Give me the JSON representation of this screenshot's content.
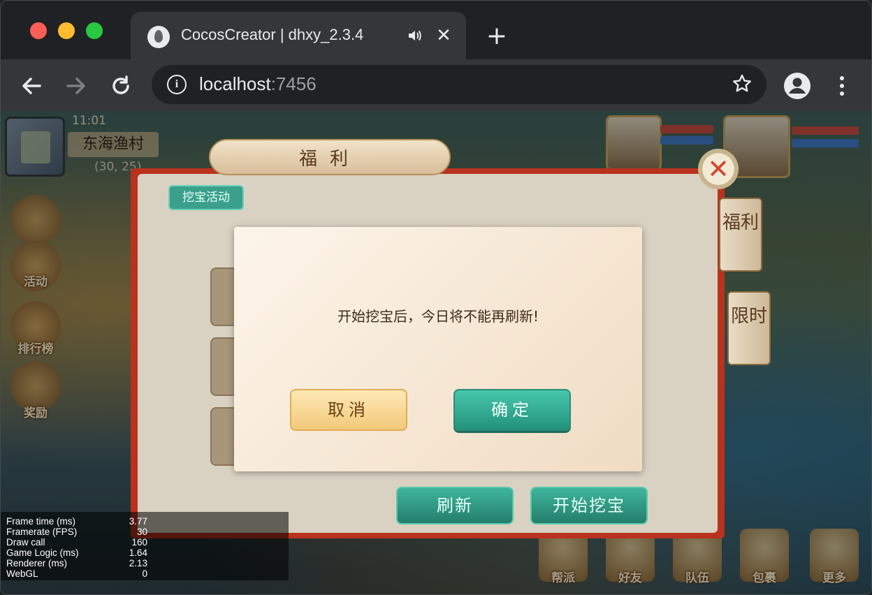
{
  "browser": {
    "tab_title": "CocosCreator | dhxy_2.3.4",
    "url_host": "localhost",
    "url_port": ":7456",
    "new_tab_symbol": "+",
    "close_symbol": "✕"
  },
  "hud": {
    "time": "11:01",
    "location": "东海渔村",
    "coords": "(30, 25)",
    "side_buttons": [
      "活动",
      "排行榜",
      "奖励"
    ],
    "bottom_buttons": [
      "帮派",
      "好友",
      "队伍",
      "包裹",
      "更多"
    ]
  },
  "welfare_panel": {
    "title": "福利",
    "active_tab": "挖宝活动",
    "side_tabs": [
      "福利",
      "限时"
    ],
    "refresh_button": "刷新",
    "start_button": "开始挖宝"
  },
  "dialog": {
    "message": "开始挖宝后，今日将不能再刷新!",
    "cancel_label": "取消",
    "confirm_label": "确定"
  },
  "stats": [
    {
      "label": "Frame time (ms)",
      "value": "3.77"
    },
    {
      "label": "Framerate (FPS)",
      "value": "30"
    },
    {
      "label": "Draw call",
      "value": "160"
    },
    {
      "label": "Game Logic (ms)",
      "value": "1.64"
    },
    {
      "label": "Renderer (ms)",
      "value": "2.13"
    },
    {
      "label": "WebGL",
      "value": "0"
    }
  ],
  "colors": {
    "chrome_dark": "#202124",
    "chrome_toolbar": "#35363a",
    "teal_button": "#2fa68e",
    "cancel_button": "#f4cf86",
    "panel_frame": "#b8321e"
  }
}
